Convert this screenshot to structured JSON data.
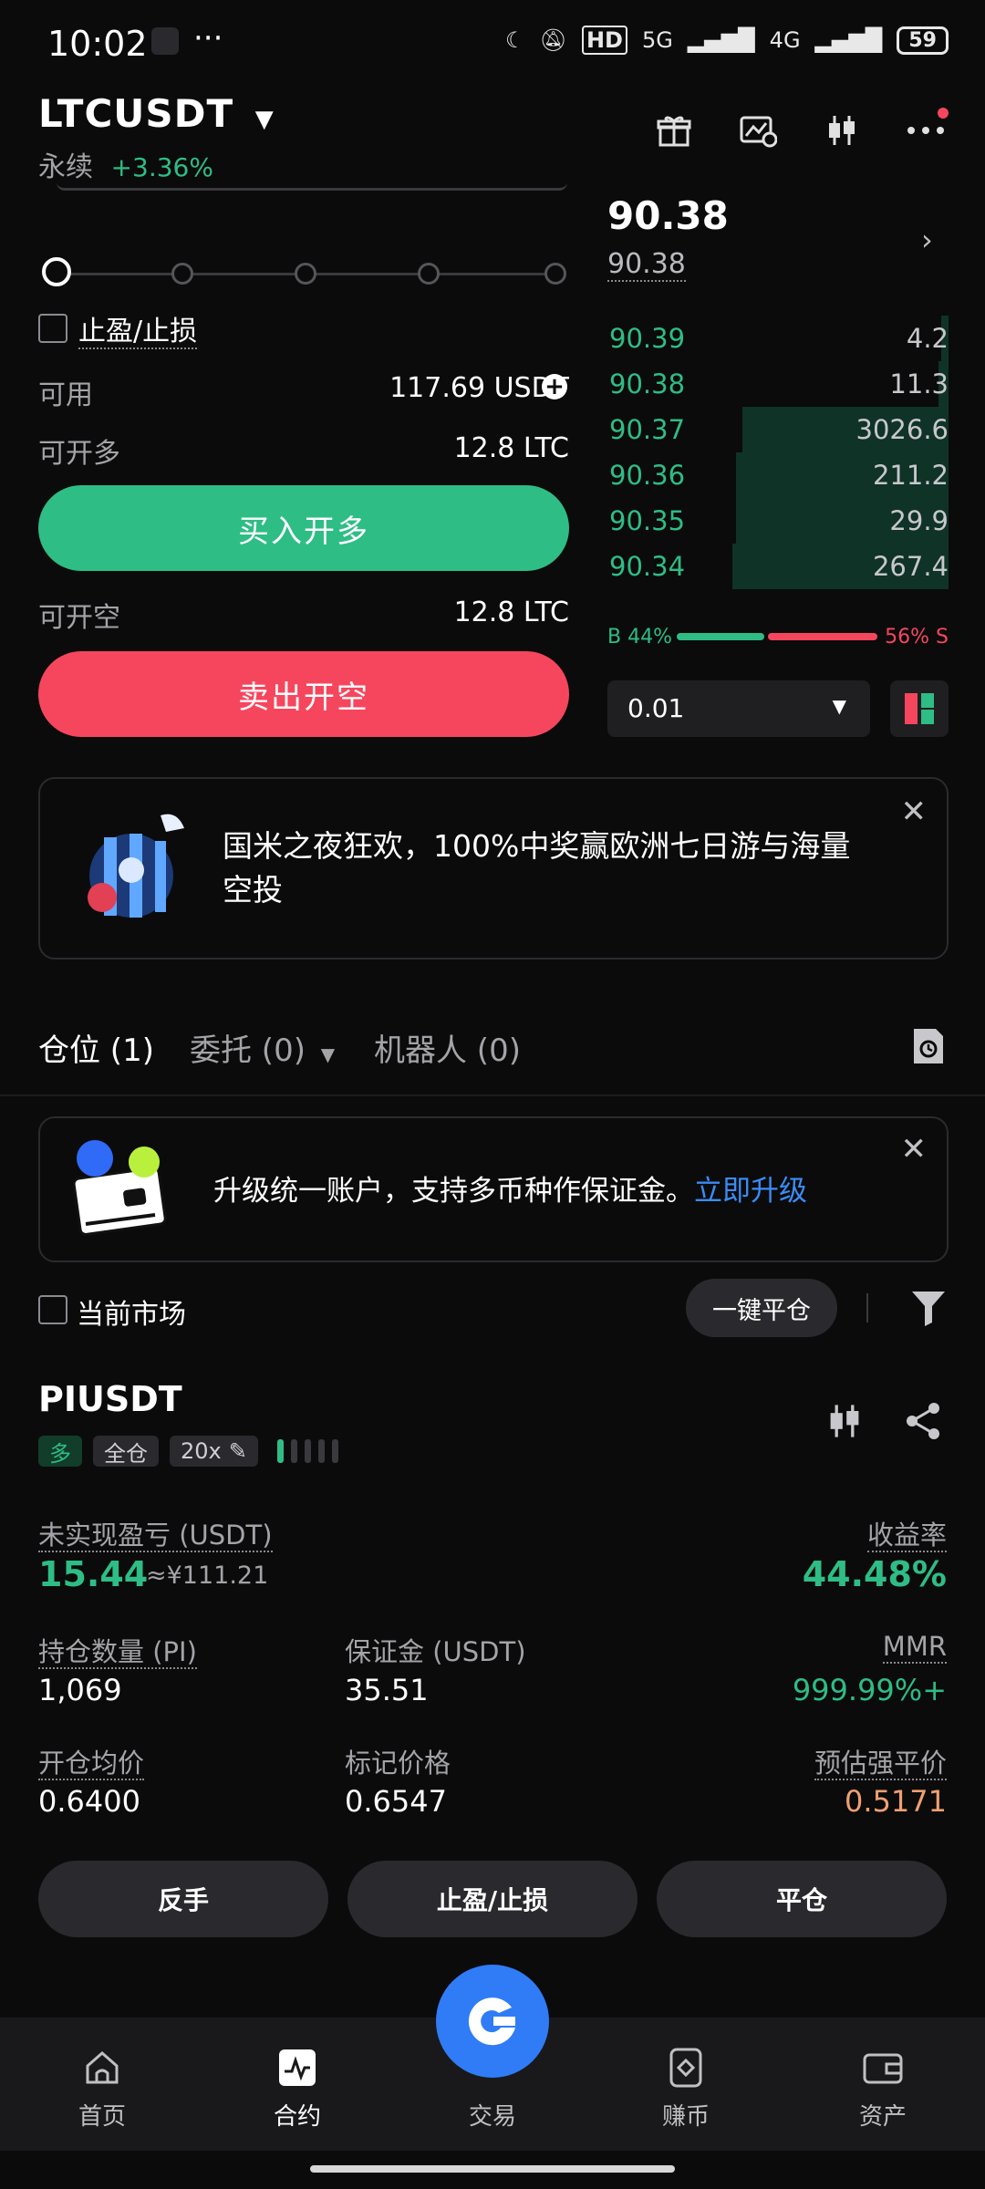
{
  "status_bar": {
    "time": "10:02",
    "more": "···",
    "hd": "HD",
    "net5g": "5G",
    "net4g": "4G",
    "battery": "59"
  },
  "header": {
    "pair": "LTCUSDT",
    "type": "永续",
    "change": "+3.36%"
  },
  "order_form": {
    "tp_sl_label": "止盈/止损",
    "available_label": "可用",
    "available_value": "117.69 USDT",
    "long_label": "可开多",
    "long_value": "12.8 LTC",
    "buy_button": "买入开多",
    "short_label": "可开空",
    "short_value": "12.8 LTC",
    "sell_button": "卖出开空"
  },
  "orderbook": {
    "last_price": "90.38",
    "mark_price": "90.38",
    "rows": [
      {
        "price": "90.39",
        "qty": "4.2",
        "depth": 0.02
      },
      {
        "price": "90.38",
        "qty": "11.3",
        "depth": 0.03
      },
      {
        "price": "90.37",
        "qty": "3026.6",
        "depth": 0.6
      },
      {
        "price": "90.36",
        "qty": "211.2",
        "depth": 0.62
      },
      {
        "price": "90.35",
        "qty": "29.9",
        "depth": 0.62
      },
      {
        "price": "90.34",
        "qty": "267.4",
        "depth": 0.63
      }
    ],
    "buy_ratio": "B 44%",
    "sell_ratio": "56% S",
    "depth_value": "0.01"
  },
  "promo": {
    "text": "国米之夜狂欢，100%中奖赢欧洲七日游与海量空投"
  },
  "tabs": {
    "positions": "仓位 (1)",
    "orders": "委托 (0)",
    "bots": "机器人 (0)"
  },
  "upgrade": {
    "text": "升级统一账户，支持多币种作保证金。",
    "link": "立即升级"
  },
  "filters": {
    "current_market": "当前市场",
    "close_all": "一键平仓"
  },
  "position": {
    "symbol": "PIUSDT",
    "side": "多",
    "mode": "全仓",
    "leverage": "20x",
    "upnl_label": "未实现盈亏 (USDT)",
    "upnl_value": "15.44",
    "upnl_cny": "≈¥111.21",
    "roe_label": "收益率",
    "roe_value": "44.48%",
    "size_label": "持仓数量 (PI)",
    "size_value": "1,069",
    "margin_label": "保证金 (USDT)",
    "margin_value": "35.51",
    "mmr_label": "MMR",
    "mmr_value": "999.99%+",
    "entry_label": "开仓均价",
    "entry_value": "0.6400",
    "mark_label": "标记价格",
    "mark_value": "0.6547",
    "liq_label": "预估强平价",
    "liq_value": "0.5171",
    "btn_reverse": "反手",
    "btn_tpsl": "止盈/止损",
    "btn_close": "平仓"
  },
  "nav": {
    "home": "首页",
    "contract": "合约",
    "trade": "交易",
    "earn": "赚币",
    "assets": "资产"
  },
  "colors": {
    "green": "#2ebd85",
    "red": "#f6465d",
    "blue": "#2f7cf6",
    "orange": "#f0a070"
  }
}
